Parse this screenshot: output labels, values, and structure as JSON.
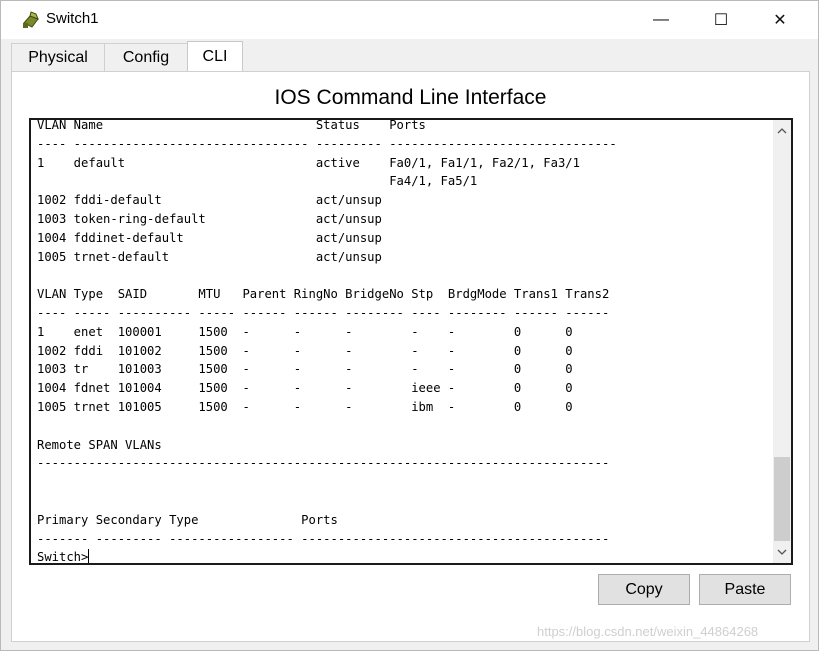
{
  "window": {
    "title": "Switch1",
    "controls": {
      "minimize": "—",
      "maximize": "☐",
      "close": "✕"
    }
  },
  "tabs": [
    {
      "label": "Physical",
      "active": false
    },
    {
      "label": "Config",
      "active": false
    },
    {
      "label": "CLI",
      "active": true
    }
  ],
  "cli": {
    "heading": "IOS Command Line Interface",
    "lines": [
      "VLAN Name                             Status    Ports",
      "---- -------------------------------- --------- -------------------------------",
      "1    default                          active    Fa0/1, Fa1/1, Fa2/1, Fa3/1",
      "                                                Fa4/1, Fa5/1",
      "1002 fddi-default                     act/unsup",
      "1003 token-ring-default               act/unsup",
      "1004 fddinet-default                  act/unsup",
      "1005 trnet-default                    act/unsup",
      "",
      "VLAN Type  SAID       MTU   Parent RingNo BridgeNo Stp  BrdgMode Trans1 Trans2",
      "---- ----- ---------- ----- ------ ------ -------- ---- -------- ------ ------",
      "1    enet  100001     1500  -      -      -        -    -        0      0",
      "1002 fddi  101002     1500  -      -      -        -    -        0      0",
      "1003 tr    101003     1500  -      -      -        -    -        0      0",
      "1004 fdnet 101004     1500  -      -      -        ieee -        0      0",
      "1005 trnet 101005     1500  -      -      -        ibm  -        0      0",
      "",
      "Remote SPAN VLANs",
      "------------------------------------------------------------------------------",
      "",
      "",
      "Primary Secondary Type              Ports",
      "------- --------- ----------------- ------------------------------------------"
    ],
    "prompt": "Switch>"
  },
  "buttons": {
    "copy": "Copy",
    "paste": "Paste"
  },
  "watermark": "https://blog.csdn.net/weixin_44864268",
  "icons": {
    "app": "switch-icon",
    "scroll_up": "chevron-up-icon",
    "scroll_down": "chevron-down-icon"
  }
}
